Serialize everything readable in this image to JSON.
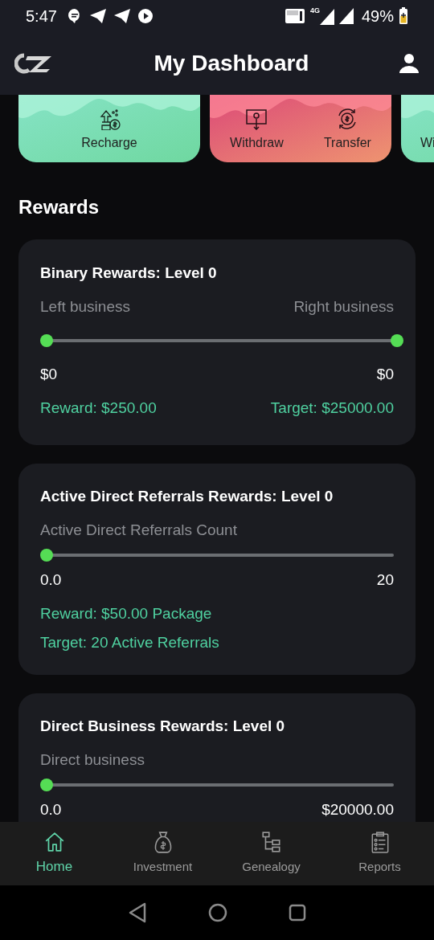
{
  "status_bar": {
    "time": "5:47",
    "network": "4G",
    "battery": "49%"
  },
  "app_bar": {
    "title": "My Dashboard"
  },
  "action_cards": [
    {
      "kind": "green",
      "actions": [
        {
          "kind": "recharge",
          "label": "Recharge"
        }
      ]
    },
    {
      "kind": "red",
      "actions": [
        {
          "kind": "withdraw",
          "label": "Withdraw"
        },
        {
          "kind": "transfer",
          "label": "Transfer"
        }
      ]
    },
    {
      "kind": "green",
      "actions": [
        {
          "kind": "cut",
          "label": "Wi"
        }
      ]
    }
  ],
  "rewards": {
    "title": "Rewards",
    "cards": [
      {
        "kind": "range",
        "title": "Binary Rewards: Level 0",
        "left_label": "Left business",
        "right_label": "Right business",
        "thumbs": [
          {
            "level": 0
          },
          {
            "level": 1
          }
        ],
        "min_value": "$0",
        "max_value": "$0",
        "reward": "Reward: $250.00",
        "target": "Target: $25000.00"
      },
      {
        "kind": "single",
        "title": "Active Direct Referrals Rewards: Level 0",
        "label": "Active Direct Referrals Count",
        "level": 0,
        "min_value": "0.0",
        "max_value": "20",
        "reward": "Reward: $50.00 Package",
        "target": "Target: 20 Active Referrals"
      },
      {
        "kind": "single",
        "title": "Direct Business Rewards: Level 0",
        "label": "Direct business",
        "level": 0,
        "min_value": "0.0",
        "max_value": "$20000.00"
      }
    ]
  },
  "bottom_nav": [
    {
      "kind": "home",
      "label": "Home",
      "selected": true
    },
    {
      "kind": "bag",
      "label": "Investment",
      "selected": false
    },
    {
      "kind": "tree",
      "label": "Genealogy",
      "selected": false
    },
    {
      "kind": "clipboard",
      "label": "Reports",
      "selected": false
    }
  ]
}
